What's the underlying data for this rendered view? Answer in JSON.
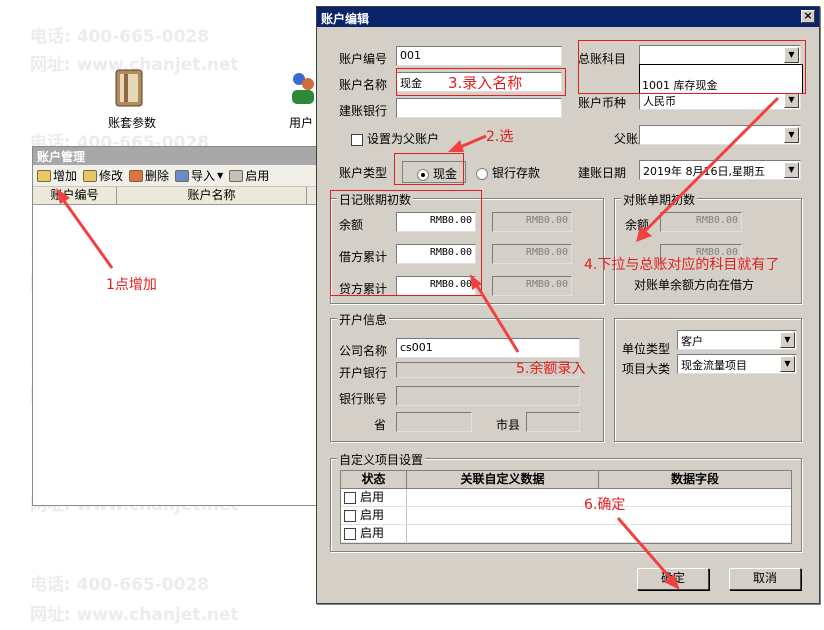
{
  "watermark": {
    "phone": "电话: 400-665-0028",
    "site": "网址: www.chanjet.net"
  },
  "desktop": {
    "icon1_label": "账套参数",
    "icon2_label": "用户"
  },
  "account_window": {
    "title": "账户管理",
    "toolbar": [
      "增加",
      "修改",
      "删除",
      "导入",
      "启用"
    ],
    "columns": [
      "账户编号",
      "账户名称"
    ]
  },
  "dialog": {
    "title": "账户编辑",
    "close": "×",
    "account_no_label": "账户编号",
    "account_no_value": "001",
    "account_name_label": "账户名称",
    "account_name_value": "现金",
    "bank_label": "建账银行",
    "parent_checkbox_label": "设置为父账户",
    "type_label": "账户类型",
    "type_cash": "现金",
    "type_bank": "银行存款",
    "gl_subject_label": "总账科目",
    "gl_subject_option": "1001  库存现金",
    "currency_label": "账户币种",
    "currency_value": "人民币",
    "parent_account_label": "父账户",
    "open_date_label": "建账日期",
    "open_date_value": "2019年 8月16日,星期五",
    "journal_group_title": "日记账期初数",
    "balance_label": "余额",
    "debit_label": "借方累计",
    "credit_label": "贷方累计",
    "journal_values": [
      "RMB0.00",
      "RMB0.00",
      "RMB0.00"
    ],
    "journal_disabled_values": [
      "RMB0.00",
      "RMB0.00",
      "RMB0.00"
    ],
    "recon_group_title": "对账单期初数",
    "recon_balance_label": "余额",
    "recon_values": [
      "RMB0.00",
      "RMB0.00"
    ],
    "recon_direction": "对账单余额方向在借方",
    "opening_group_title": "开户信息",
    "company_label": "公司名称",
    "company_value": "cs001",
    "open_bank_label": "开户银行",
    "bank_account_label": "银行账号",
    "province_label": "省",
    "city_label": "市县",
    "unit_type_label": "单位类型",
    "unit_type_value": "客户",
    "project_label": "项目大类",
    "project_value": "现金流量项目",
    "custom_group_title": "自定义项目设置",
    "grid_headers": [
      "状态",
      "关联自定义数据",
      "数据字段"
    ],
    "grid_rows": [
      "启用",
      "启用",
      "启用"
    ],
    "ok_button": "确定",
    "cancel_button": "取消"
  },
  "annotations": {
    "step1": "1点增加",
    "step2": "2.选",
    "step3": "3.录入名称",
    "step4": "4.下拉与总账对应的科目就有了",
    "step5": "5.余额录入",
    "step6": "6.确定"
  },
  "colors": {
    "dialog_bg": "#d4d0c8",
    "title_bar": "#0a246a",
    "annotation_red": "#e02020"
  }
}
